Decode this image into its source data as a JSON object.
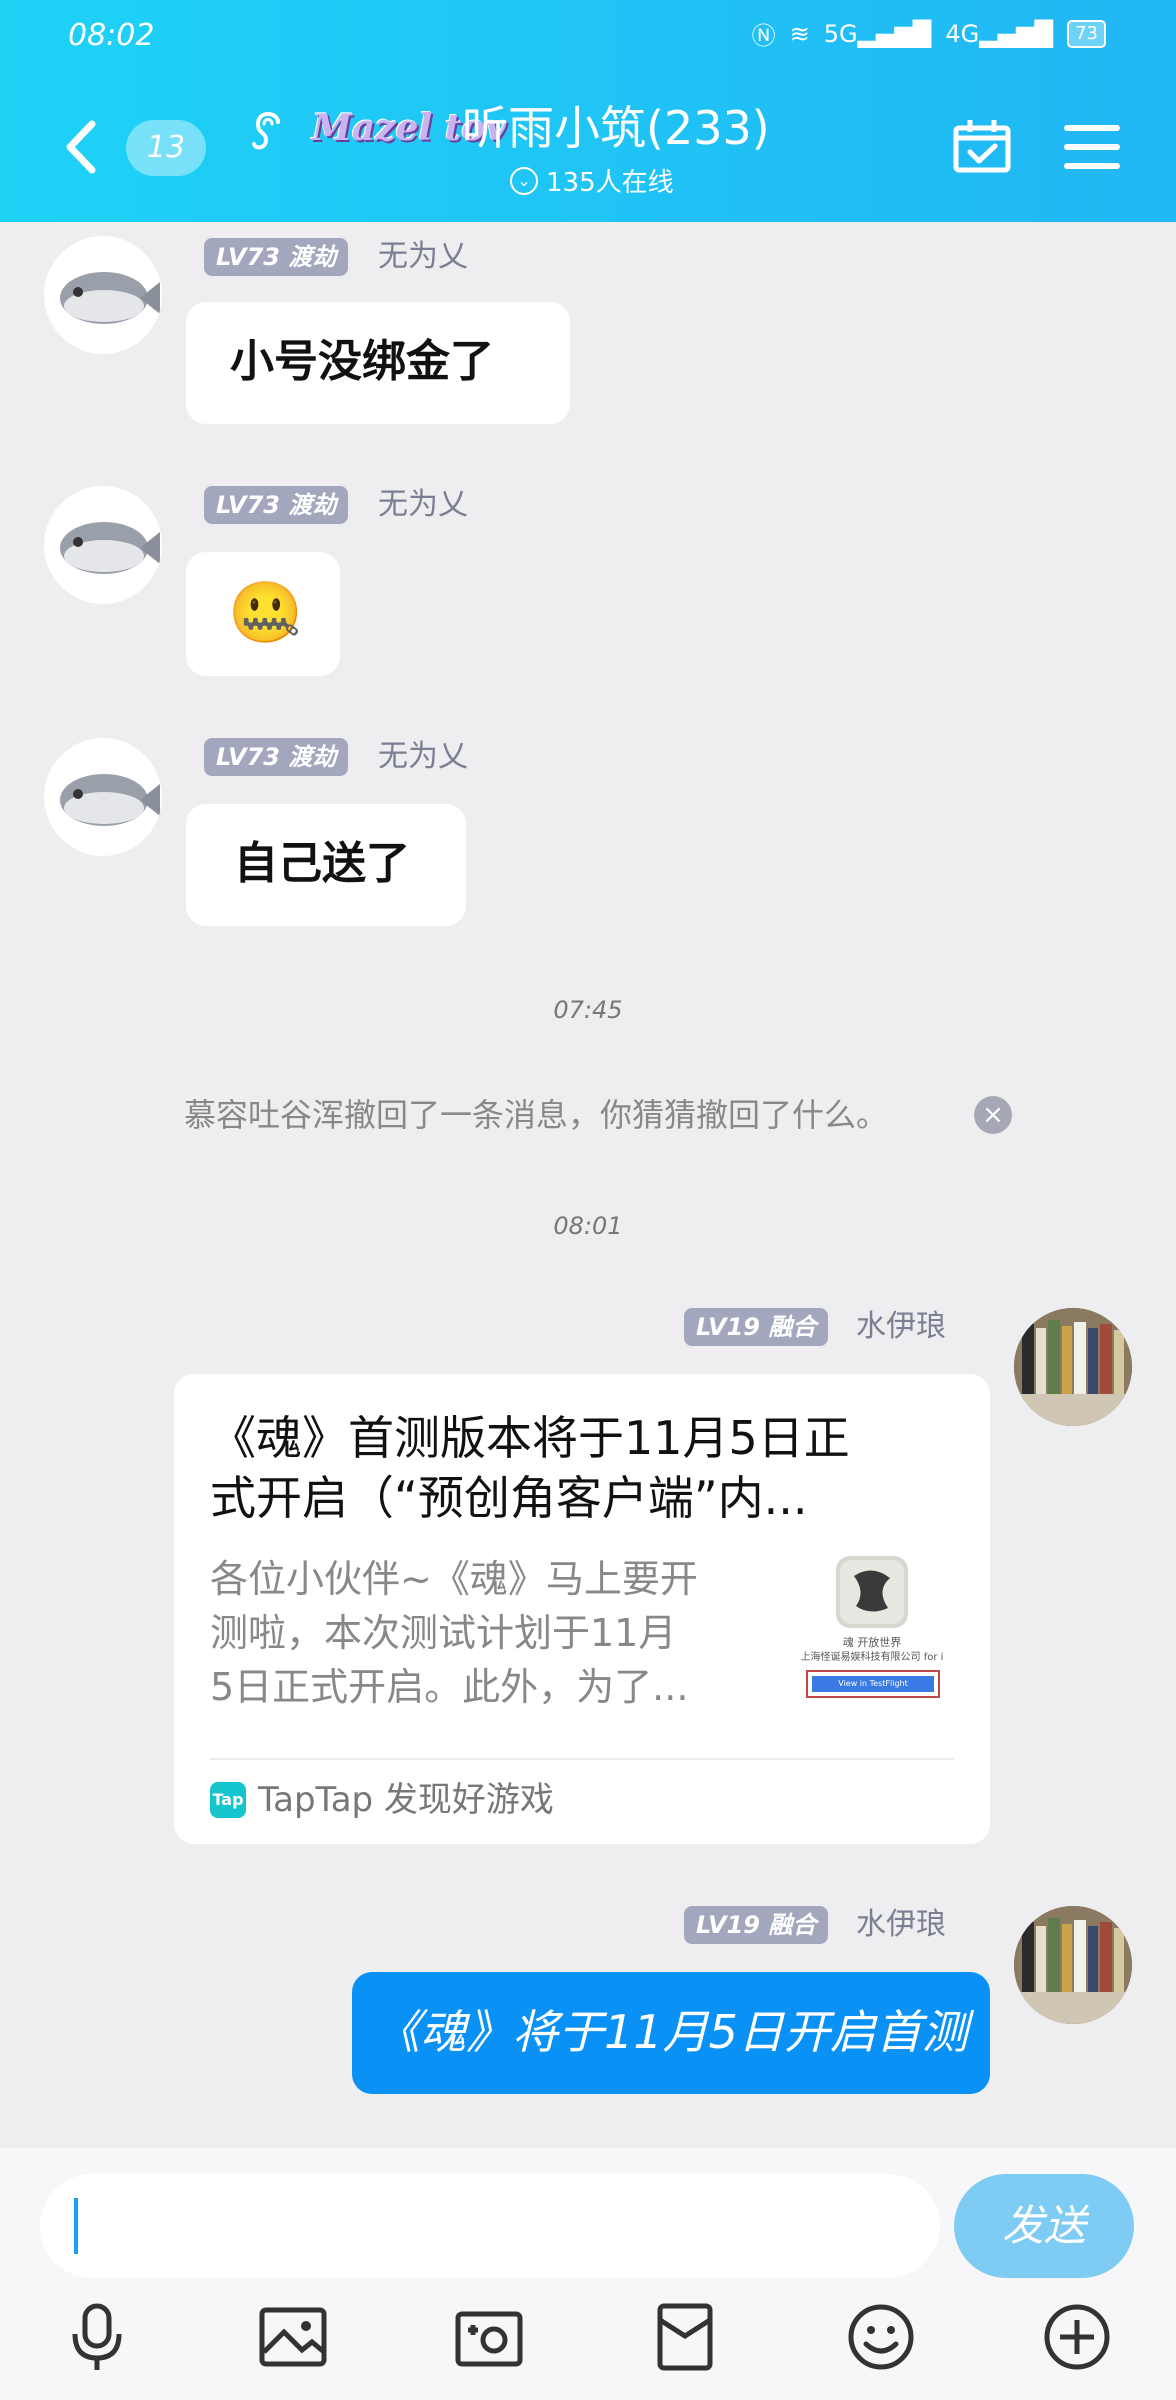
{
  "status_bar": {
    "time": "08:02",
    "signal1": "5G",
    "signal2": "4G",
    "battery": "73"
  },
  "header": {
    "unread_count": "13",
    "brand": "Mazel tov",
    "group_name": "听雨小筑(233)",
    "online": "135人在线"
  },
  "messages": [
    {
      "level": "LV73 渡劫",
      "nickname": "无为乂",
      "text": "小号没绑金了"
    },
    {
      "level": "LV73 渡劫",
      "nickname": "无为乂",
      "emoji": "🤐"
    },
    {
      "level": "LV73 渡劫",
      "nickname": "无为乂",
      "text": "自己送了"
    }
  ],
  "time_divider_1": "07:45",
  "recall_notice": "慕容吐谷浑撤回了一条消息，你猜猜撤回了什么。",
  "recall_close": "×",
  "time_divider_2": "08:01",
  "card_message": {
    "level": "LV19 融合",
    "nickname": "水伊琅",
    "title_line1": "《魂》首测版本将于11月5日正",
    "title_line2": "式开启（“预创角客户端”内...",
    "desc_line1": "各位小伙伴~《魂》马上要开",
    "desc_line2": "测啦，本次测试计划于11月",
    "desc_line3": "5日正式开启。此外，为了...",
    "thumb_title": "魂 开放世界",
    "thumb_company": "上海怪诞易娱科技有限公司",
    "thumb_platform": "for i",
    "thumb_button": "View in TestFlight",
    "source_badge": "Tap",
    "source": "TapTap 发现好游戏"
  },
  "blue_message": {
    "level": "LV19 融合",
    "nickname": "水伊琅",
    "text": "《魂》将于11月5日开启首测"
  },
  "input_bar": {
    "send_label": "发送"
  },
  "colors": {
    "header": "#21b6f4",
    "bubble_blue": "#0a91f6",
    "send": "#7ecbf3"
  }
}
